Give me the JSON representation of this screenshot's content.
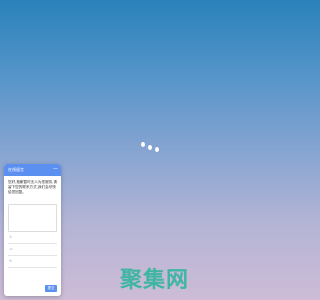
{
  "loading": {
    "indicator": "three white dots"
  },
  "feedback": {
    "title": "在线留言",
    "close_icon": "—",
    "message": "您好,抱歉暂时无人为您服务,请留下您的联系方式,我们会尽快给您回复。",
    "fields": [
      {
        "icon": "person-icon",
        "glyph": "♙"
      },
      {
        "icon": "phone-icon",
        "glyph": "☏"
      },
      {
        "icon": "email-icon",
        "glyph": "✉"
      }
    ],
    "submit_label": "提交"
  },
  "watermark": {
    "text": "聚集网",
    "color": "#30b69e"
  },
  "colors": {
    "accent": "#5b8ff0",
    "background_top": "#2a82bb",
    "background_bottom": "#cdbcd6"
  }
}
